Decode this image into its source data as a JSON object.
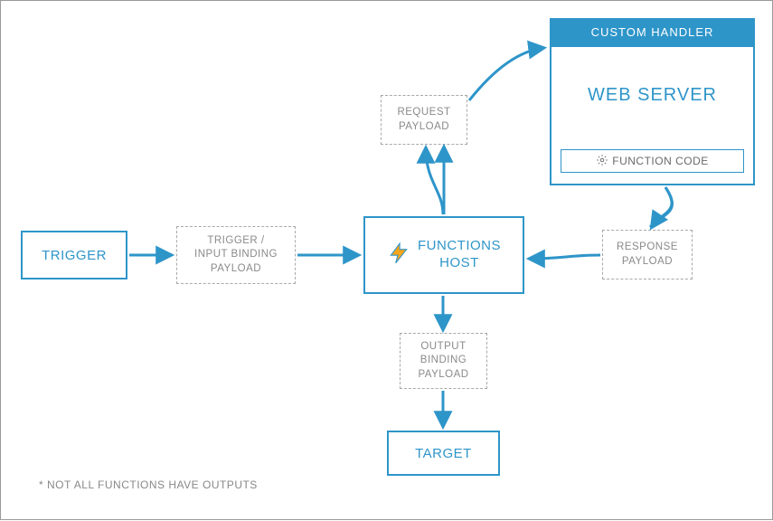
{
  "boxes": {
    "trigger": "TRIGGER",
    "input_payload": "TRIGGER /\nINPUT BINDING\nPAYLOAD",
    "functions_host": "FUNCTIONS\nHOST",
    "request_payload": "REQUEST\nPAYLOAD",
    "custom_handler_header": "CUSTOM HANDLER",
    "web_server": "WEB SERVER",
    "function_code": "FUNCTION CODE",
    "response_payload": "RESPONSE\nPAYLOAD",
    "output_payload": "OUTPUT\nBINDING\nPAYLOAD",
    "target": "TARGET"
  },
  "footnote": "* NOT ALL FUNCTIONS HAVE OUTPUTS",
  "icons": {
    "bolt": "bolt-icon",
    "gear": "gear-icon"
  },
  "colors": {
    "primary": "#2e95c9",
    "muted": "#8a8a8a",
    "accent": "#f7a51b"
  }
}
